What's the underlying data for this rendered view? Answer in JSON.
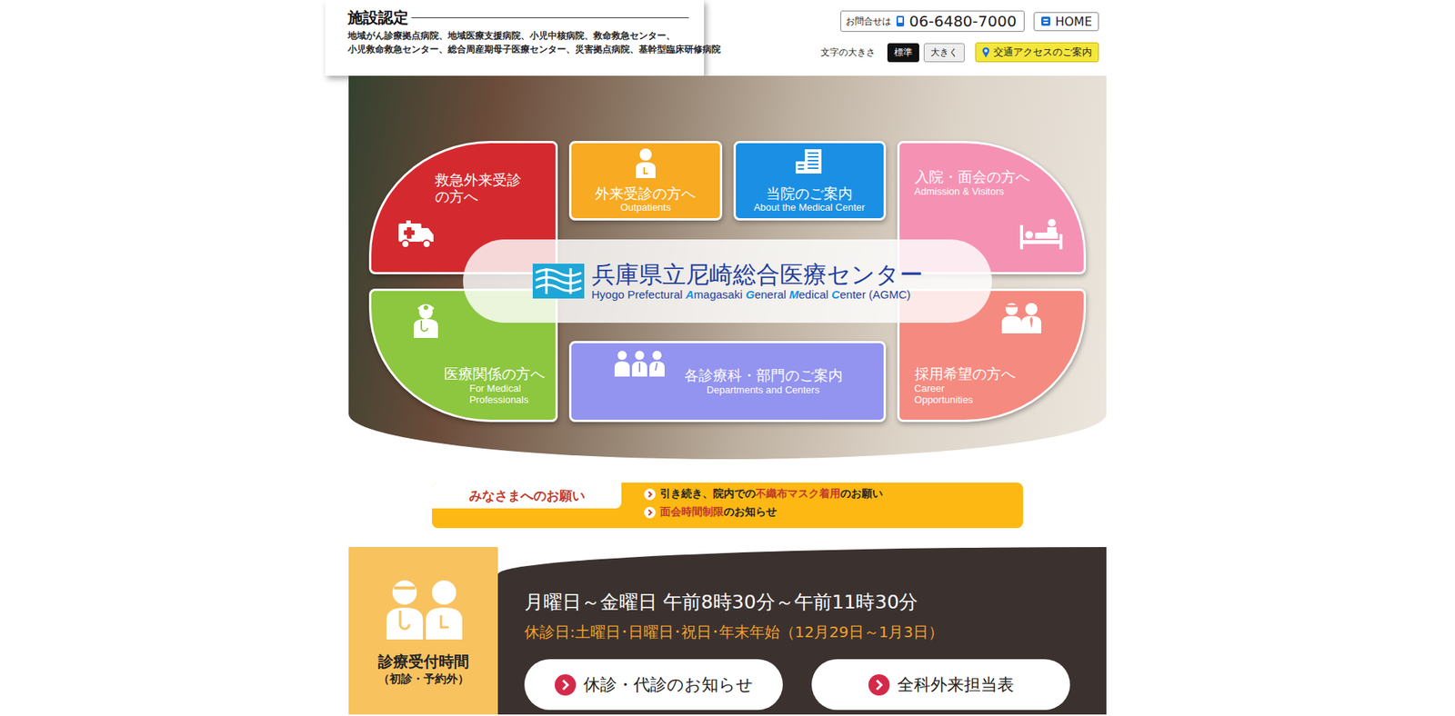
{
  "header": {
    "title": "施設認定",
    "certifications": [
      "地域がん診療拠点病院、地域医療支援病院、小児中核病院、救命救急センター、",
      "小児救命救急センター、総合周産期母子医療センター、災害拠点病院、基幹型臨床研修病院"
    ],
    "contact_label": "お問合せは",
    "phone": "06-6480-7000",
    "home": "HOME",
    "font_size_label": "文字の大きさ",
    "font_sizes": [
      {
        "label": "標準",
        "selected": true
      },
      {
        "label": "大きく",
        "selected": false
      }
    ],
    "access": "交通アクセスのご案内"
  },
  "menu": [
    {
      "kind": "arc",
      "lines": [
        "救急外来受診",
        "の方へ"
      ],
      "sub": [],
      "color": "#d42a2f"
    },
    {
      "kind": "box",
      "lines": [
        "外来受診の方へ"
      ],
      "sub": [
        "Outpatients"
      ],
      "color": "#f7aa22"
    },
    {
      "kind": "box",
      "lines": [
        "当院のご案内"
      ],
      "sub": [
        "About the Medical Center"
      ],
      "color": "#1a8fe3"
    },
    {
      "kind": "arc",
      "lines": [
        "入院・面会の方へ"
      ],
      "sub": [
        "Admission & Visitors"
      ],
      "color": "#f592b4"
    },
    {
      "kind": "arc",
      "lines": [
        "医療関係の方へ"
      ],
      "sub": [
        "For Medical",
        "Professionals"
      ],
      "color": "#8dc63f"
    },
    {
      "kind": "box",
      "lines": [
        "各診療科・部門のご案内"
      ],
      "sub": [
        "Departments and Centers"
      ],
      "color": "#9393f0"
    },
    {
      "kind": "arc",
      "lines": [
        "採用希望の方へ"
      ],
      "sub": [
        "Career",
        "Opportunities"
      ],
      "color": "#f58a80"
    }
  ],
  "logo": {
    "name": "兵庫県立尼崎総合医療センター",
    "english": [
      {
        "text": "Hyogo Prefectural ",
        "accent": false
      },
      {
        "text": "A",
        "accent": true
      },
      {
        "text": "magasaki ",
        "accent": false
      },
      {
        "text": "G",
        "accent": true
      },
      {
        "text": "eneral ",
        "accent": false
      },
      {
        "text": "M",
        "accent": true
      },
      {
        "text": "edical ",
        "accent": false
      },
      {
        "text": "C",
        "accent": true
      },
      {
        "text": "enter (AGMC)",
        "accent": false
      }
    ]
  },
  "notice": {
    "label": "みなさまへのお願い",
    "items": [
      [
        {
          "text": "引き続き、院内での",
          "highlight": false
        },
        {
          "text": "不織布マスク着用",
          "highlight": true
        },
        {
          "text": "のお願い",
          "highlight": false
        }
      ],
      [
        {
          "text": "面会時間制限",
          "highlight": true
        },
        {
          "text": "のお知らせ",
          "highlight": false
        }
      ]
    ]
  },
  "reception": {
    "title": "診療受付時間",
    "subtitle": "（初診・予約外）",
    "hours": "月曜日～金曜日 午前8時30分～午前11時30分",
    "closed": "休診日:土曜日･日曜日･祝日･年末年始（12月29日～1月3日）",
    "buttons": [
      "休診・代診のお知らせ",
      "全科外来担当表"
    ]
  }
}
